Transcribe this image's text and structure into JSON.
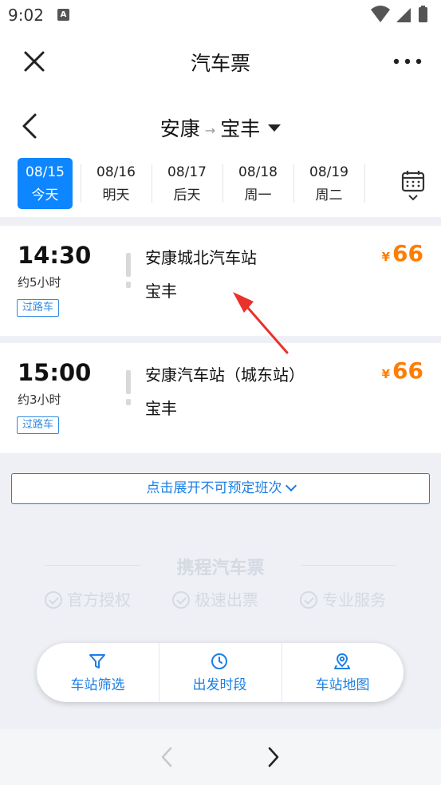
{
  "status_bar": {
    "time": "9:02",
    "notification_badge": "A"
  },
  "header": {
    "title": "汽车票"
  },
  "route": {
    "from": "安康",
    "to": "宝丰"
  },
  "date_tabs": [
    {
      "date": "08/15",
      "weekday": "今天",
      "selected": true
    },
    {
      "date": "08/16",
      "weekday": "明天",
      "selected": false
    },
    {
      "date": "08/17",
      "weekday": "后天",
      "selected": false
    },
    {
      "date": "08/18",
      "weekday": "周一",
      "selected": false
    },
    {
      "date": "08/19",
      "weekday": "周二",
      "selected": false
    }
  ],
  "tickets": [
    {
      "time": "14:30",
      "duration": "约5小时",
      "tag": "过路车",
      "from": "安康城北汽车站",
      "to": "宝丰",
      "currency": "¥",
      "price": "66"
    },
    {
      "time": "15:00",
      "duration": "约3小时",
      "tag": "过路车",
      "from": "安康汽车站（城东站）",
      "to": "宝丰",
      "currency": "¥",
      "price": "66"
    }
  ],
  "expand_label": "点击展开不可预定班次",
  "brand": {
    "name": "携程汽车票",
    "features": [
      "官方授权",
      "极速出票",
      "专业服务"
    ]
  },
  "filter_bar": [
    {
      "icon": "funnel-icon",
      "label": "车站筛选"
    },
    {
      "icon": "clock-icon",
      "label": "出发时段"
    },
    {
      "icon": "map-pin-icon",
      "label": "车站地图"
    }
  ],
  "colors": {
    "accent": "#0d86ff",
    "price": "#ff7d00",
    "annotation_arrow": "#e8322a"
  }
}
